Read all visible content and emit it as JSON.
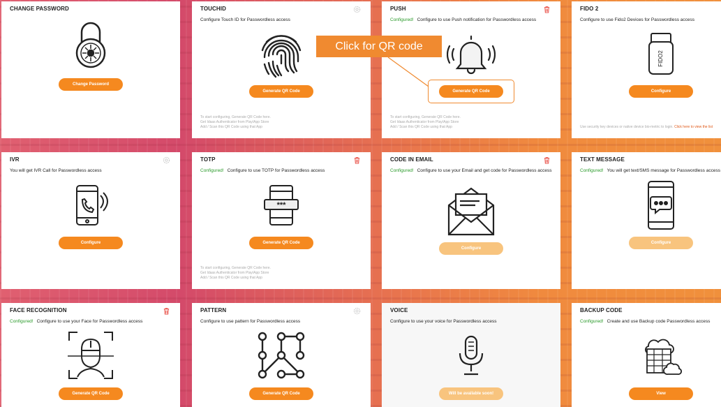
{
  "callout": {
    "text": "Click for QR code"
  },
  "cards": {
    "change_password": {
      "title": "CHANGE PASSWORD",
      "button": "Change Password"
    },
    "touchid": {
      "title": "TOUCHID",
      "desc": "Configure Touch ID for Passwordless access",
      "button": "Generate QR Code",
      "foot": [
        "To start configuring, Generate QR Code here.",
        "Get Idaas Authenticator from Play/App Store",
        "Add / Scan this QR Code using that App"
      ]
    },
    "push": {
      "title": "PUSH",
      "status": "Configured!",
      "desc": "Configure to use Push notification for Passwordless access",
      "button": "Generate QR Code",
      "foot": [
        "To start configuring, Generate QR Code here.",
        "Get Idaas Authenticator from Play/App Store",
        "Add / Scan this QR Code using that App"
      ]
    },
    "fido2": {
      "title": "FIDO 2",
      "desc": "Configure to use Fido2 Devices for Passwordless access",
      "button": "Configure",
      "device_label": "FIDO2",
      "foot": "Use security key devices or native device bio-metric to login. ",
      "foot_link": "Click here to view the list"
    },
    "ivr": {
      "title": "IVR",
      "desc": "You will get IVR Call for Passwordless access",
      "button": "Configure"
    },
    "totp": {
      "title": "TOTP",
      "status": "Configured!",
      "desc": "Configure to use TOTP for Passwordless access",
      "button": "Generate QR Code",
      "code_mask": "***",
      "foot": [
        "To start configuring, Generate QR Code here.",
        "Get Idaas Authenticator from Play/App Store",
        "Add / Scan this QR Code using that App"
      ]
    },
    "code_in_email": {
      "title": "CODE IN EMAIL",
      "status": "Configured!",
      "desc": "Configure to use your Email and get code for Passwordless access",
      "button": "Configure"
    },
    "text_message": {
      "title": "TEXT MESSAGE",
      "status": "Configured!",
      "desc": "You will get text/SMS message for Passwordless access",
      "button": "Configure"
    },
    "face_recognition": {
      "title": "FACE RECOGNITION",
      "status": "Configured!",
      "desc": "Configure to use your Face for Passwordless access",
      "button": "Generate QR Code"
    },
    "pattern": {
      "title": "PATTERN",
      "desc": "Configure to use pattern for Passwordless access",
      "button": "Generate QR Code"
    },
    "voice": {
      "title": "VOICE",
      "desc": "Configure to use your voice for Passwordless access",
      "button": "Will be available soon!"
    },
    "backup_code": {
      "title": "BACKUP CODE",
      "status": "Configured!",
      "desc": "Create and use Backup code Passwordless access",
      "button": "View"
    }
  },
  "colors": {
    "accent": "#f5891f",
    "configured": "#2a9a2a",
    "delete": "#e8453c"
  }
}
